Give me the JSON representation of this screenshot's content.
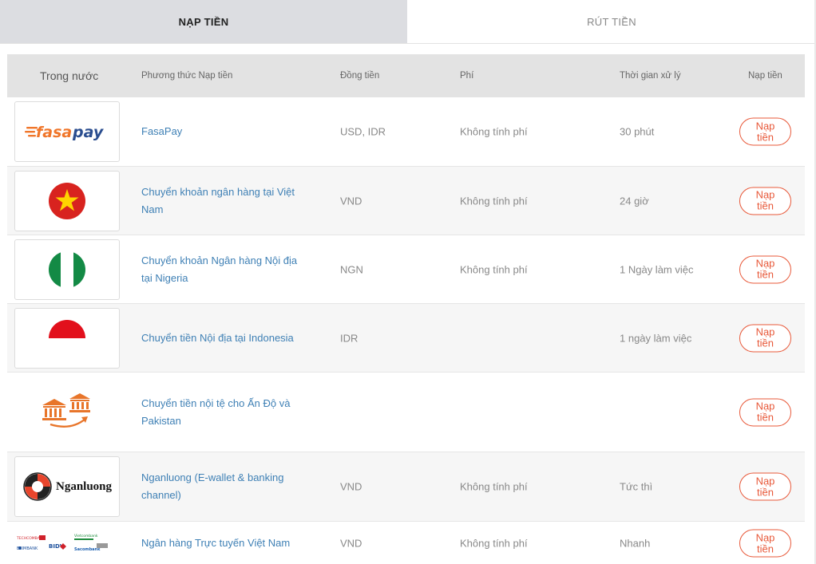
{
  "tabs": {
    "deposit": "NẠP TIỀN",
    "withdraw": "RÚT TIỀN"
  },
  "header": {
    "domestic": "Trong nước",
    "method": "Phương thức Nạp tiền",
    "currency": "Đồng tiền",
    "fee": "Phí",
    "time": "Thời gian xử lý",
    "deposit": "Nạp tiền"
  },
  "rows": [
    {
      "logo": "fasapay-logo",
      "method": "FasaPay",
      "currency": "USD, IDR",
      "fee": "Không tính phí",
      "time": "30 phút",
      "button": "Nạp tiền"
    },
    {
      "logo": "vietnam-flag-icon",
      "method": "Chuyển khoản ngân hàng tại Việt Nam",
      "currency": "VND",
      "fee": "Không tính phí",
      "time": "24 giờ",
      "button": "Nạp tiền"
    },
    {
      "logo": "nigeria-flag-icon",
      "method": "Chuyển khoản Ngân hàng Nội địa tại Nigeria",
      "currency": "NGN",
      "fee": "Không tính phí",
      "time": "1 Ngày làm việc",
      "button": "Nạp tiền"
    },
    {
      "logo": "indonesia-flag-icon",
      "method": "Chuyển tiền Nội địa tại Indonesia",
      "currency": "IDR",
      "fee": "",
      "time": "1 ngày làm việc",
      "button": "Nạp tiền"
    },
    {
      "logo": "bank-transfer-icon",
      "method": "Chuyển tiền nội tệ cho Ấn Độ và Pakistan",
      "currency": "",
      "fee": "",
      "time": "",
      "button": "Nạp tiền"
    },
    {
      "logo": "nganluong-logo",
      "logo_text": "Nganluong",
      "method": "Nganluong (E-wallet & banking channel)",
      "currency": "VND",
      "fee": "Không tính phí",
      "time": "Tức thì",
      "button": "Nạp tiền"
    },
    {
      "logo": "vietnam-banks-logos",
      "logo_labels": [
        "TECHCOMBANK",
        "BIDV",
        "Vietcombank",
        "EXIMBANK",
        "Sacombank"
      ],
      "method": "Ngân hàng Trực tuyến Việt Nam",
      "currency": "VND",
      "fee": "Không tính phí",
      "time": "Nhanh",
      "button": "Nạp tiền"
    }
  ],
  "colors": {
    "accent": "#e8593a",
    "link": "#3f80b5",
    "header_bg": "#e3e3e3",
    "active_tab_bg": "#dcdde1",
    "fasapay_orange": "#f0762a",
    "fasapay_blue": "#2a4d8f"
  }
}
